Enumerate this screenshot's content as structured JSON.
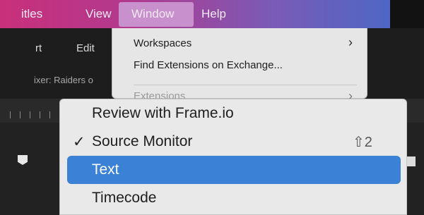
{
  "menubar": {
    "items": [
      {
        "label": "itles"
      },
      {
        "label": "View"
      },
      {
        "label": "Window"
      },
      {
        "label": "Help"
      }
    ]
  },
  "app": {
    "tab_left": "rt",
    "tab_edit": "Edit",
    "mixer_label": "ixer: Raiders o"
  },
  "window_menu_small": {
    "items": [
      {
        "label": "Workspaces",
        "has_submenu": true
      },
      {
        "label": "Find Extensions on Exchange..."
      },
      {
        "label": "Extensions",
        "has_submenu": true,
        "disabled": true
      }
    ]
  },
  "window_menu_large": {
    "items": [
      {
        "label": "Review with Frame.io"
      },
      {
        "label": "Source Monitor",
        "checked": true,
        "shortcut": "⇧2"
      },
      {
        "label": "Text",
        "selected": true
      },
      {
        "label": "Timecode"
      }
    ]
  },
  "colors": {
    "highlight": "#3b82d6",
    "menubar_start": "#c9307a",
    "menubar_end": "#4e67c4"
  },
  "icons": {
    "chevron": "chevron-right-icon",
    "check": "checkmark-icon",
    "playhead": "playhead-marker-icon"
  }
}
